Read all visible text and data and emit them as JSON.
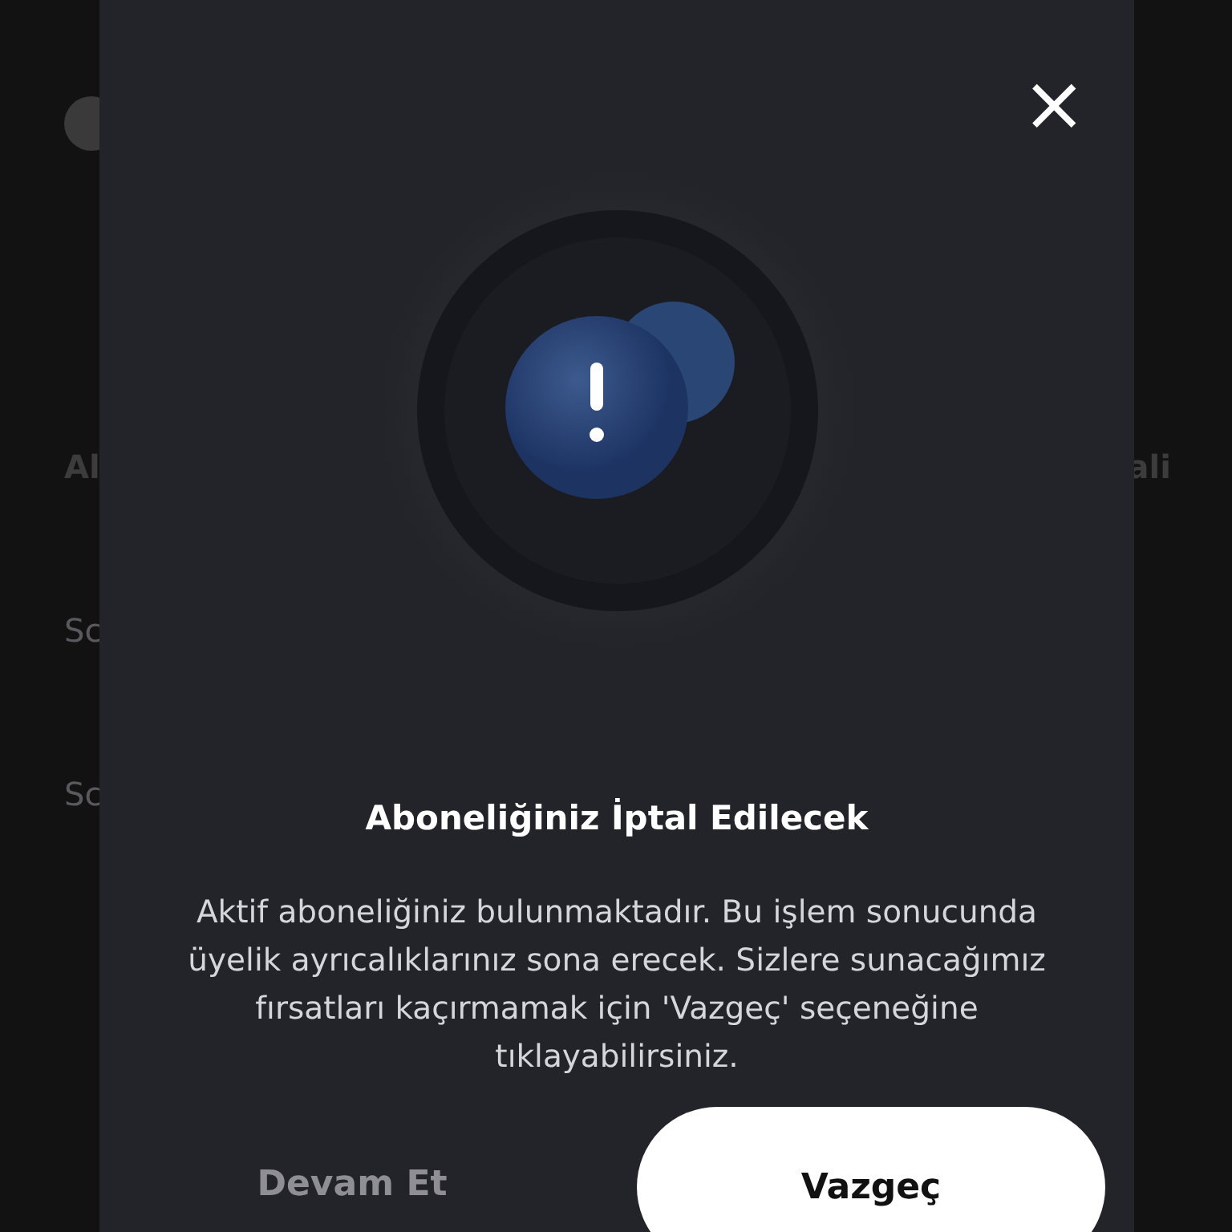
{
  "background": {
    "heading": "Al",
    "heading_right": "ali",
    "rows": [
      "Sc",
      "Sc"
    ]
  },
  "dialog": {
    "close_label": "×",
    "title": "Aboneliğiniz İptal Edilecek",
    "message": "Aktif aboneliğiniz bulunmaktadır. Bu işlem sonucunda üyelik ayrıcalıklarınız sona erecek. Sizlere sunacağımız fırsatları kaçırmamak için 'Vazgeç' seçeneğine tıklayabilirsiniz.",
    "buttons": [
      {
        "label": "Devam Et",
        "kind": "text"
      },
      {
        "label": "Vazgeç",
        "kind": "primary"
      }
    ]
  }
}
